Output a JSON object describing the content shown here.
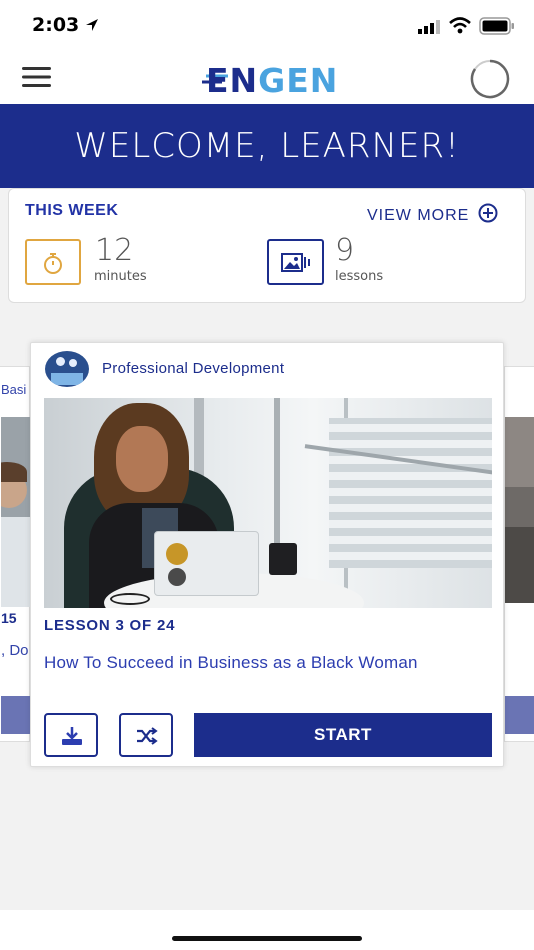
{
  "status": {
    "time": "2:03"
  },
  "header": {
    "logo_text": "ENGEN"
  },
  "banner": {
    "title": "WELCOME, LEARNER!"
  },
  "this_week": {
    "label": "THIS WEEK",
    "view_more": "VIEW MORE",
    "minutes_value": "12",
    "minutes_unit": "minutes",
    "lessons_value": "9",
    "lessons_unit": "lessons"
  },
  "carousel": {
    "left_peek": {
      "category_fragment": "Basi",
      "num_fragment": "15",
      "title_fragment": ", Do"
    },
    "card": {
      "category": "Professional Development",
      "lesson_progress": "LESSON 3 OF 24",
      "title": "How To Succeed in Business as a Black Woman",
      "start_label": "START"
    }
  },
  "colors": {
    "brand_blue": "#1c2d8c",
    "accent_light_blue": "#4aa3df",
    "timer_orange": "#e0a640"
  }
}
